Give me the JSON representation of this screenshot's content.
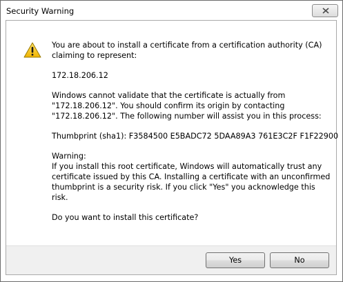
{
  "window": {
    "title": "Security Warning"
  },
  "message": {
    "intro_line1": "You are about to install a certificate from a certification authority (CA)",
    "intro_line2": "claiming to represent:",
    "address": "172.18.206.12",
    "validate_line1": "Windows cannot validate that the certificate is actually from",
    "validate_line2": "\"172.18.206.12\". You should confirm its origin by contacting",
    "validate_line3": "\"172.18.206.12\". The following number will assist you in this process:",
    "thumbprint": "Thumbprint (sha1): F3584500 E5BADC72 5DAA89A3 761E3C2F F1F22900",
    "warning_heading": "Warning:",
    "warning_line1": "If you install this root certificate, Windows will automatically trust any",
    "warning_line2": "certificate issued by this CA. Installing a certificate with an unconfirmed",
    "warning_line3": "thumbprint is a security risk. If you click \"Yes\" you acknowledge this",
    "warning_line4": "risk.",
    "question": "Do you want to install this certificate?"
  },
  "buttons": {
    "yes_label": "Yes",
    "no_label": "No"
  },
  "icons": {
    "close": "close-icon",
    "warning": "warning-triangle-icon"
  },
  "colors": {
    "warning_yellow": "#f5c21b",
    "warning_border": "#9a7a00",
    "footer_bg": "#f0f0f0"
  }
}
